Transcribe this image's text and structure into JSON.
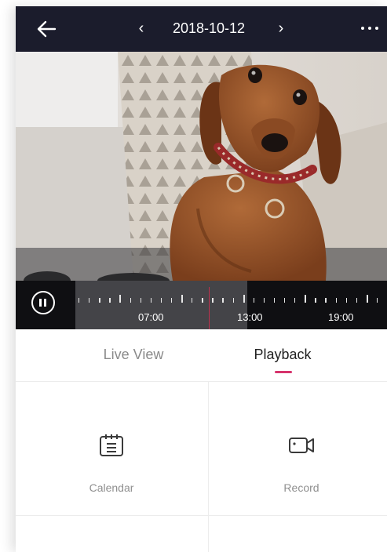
{
  "header": {
    "back_icon": "arrow-left-icon",
    "prev_glyph": "‹",
    "date": "2018-10-12",
    "next_glyph": "›",
    "more_icon": "more-dots-icon",
    "background": "#1b1c2c"
  },
  "video": {
    "content": "dachshund-camera-feed"
  },
  "timeline": {
    "labels": [
      "07:00",
      "13:00",
      "19:00"
    ],
    "playhead_color": "#c0304d"
  },
  "tabs": {
    "live_view": "Live View",
    "playback": "Playback",
    "accent": "#d6336c"
  },
  "actions": {
    "calendar": "Calendar",
    "record": "Record"
  }
}
